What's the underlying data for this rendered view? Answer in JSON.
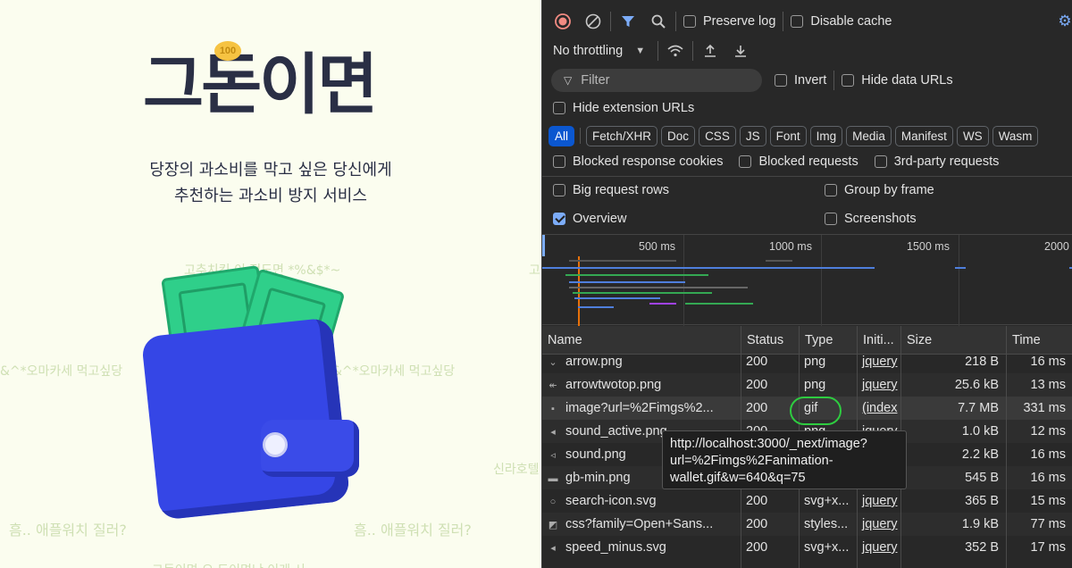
{
  "app": {
    "logo_text": "그돈이면",
    "coin_label": "100",
    "tagline_line1": "당장의 과소비를 막고 싶은 당신에게",
    "tagline_line2": "추천하는 과소비 방지 서비스",
    "bg_texts": [
      "고추치킨 이 정도면 *%&$*~",
      "&^*오마카세 먹고싶당",
      "&^*오마카세 먹고싶당",
      "흠.. 애플워치 질러?",
      "흠.. 애플워치 질러?",
      "신라호텔",
      "고",
      "오마카세",
      "그돈이면 오 도이면난 이게 사"
    ]
  },
  "devtools": {
    "toolbar": {
      "preserve_log": "Preserve log",
      "disable_cache": "Disable cache",
      "throttling": "No throttling"
    },
    "filter": {
      "placeholder": "Filter",
      "invert": "Invert",
      "hide_data_urls": "Hide data URLs",
      "hide_extension_urls": "Hide extension URLs"
    },
    "type_chips": [
      "All",
      "Fetch/XHR",
      "Doc",
      "CSS",
      "JS",
      "Font",
      "Img",
      "Media",
      "Manifest",
      "WS",
      "Wasm"
    ],
    "options": {
      "blocked_cookies": "Blocked response cookies",
      "blocked_requests": "Blocked requests",
      "third_party": "3rd-party requests",
      "big_rows": "Big request rows",
      "group_by_frame": "Group by frame",
      "overview": "Overview",
      "screenshots": "Screenshots"
    },
    "timeline_labels": [
      "500 ms",
      "1000 ms",
      "1500 ms",
      "2000"
    ],
    "columns": [
      "Name",
      "Status",
      "Type",
      "Initi...",
      "Size",
      "Time"
    ],
    "rows": [
      {
        "icon": "⌄",
        "name": "arrow.png",
        "status": "200",
        "type": "png",
        "initiator": "jquery",
        "size": "218 B",
        "time": "16 ms"
      },
      {
        "icon": "↞",
        "name": "arrowtwotop.png",
        "status": "200",
        "type": "png",
        "initiator": "jquery",
        "size": "25.6 kB",
        "time": "13 ms"
      },
      {
        "icon": "▪",
        "name": "image?url=%2Fimgs%2...",
        "status": "200",
        "type": "gif",
        "initiator": "(index",
        "size": "7.7 MB",
        "time": "331 ms"
      },
      {
        "icon": "◂",
        "name": "sound_active.png",
        "status": "200",
        "type": "png",
        "initiator": "jquery",
        "size": "1.0 kB",
        "time": "12 ms"
      },
      {
        "icon": "◃",
        "name": "sound.png",
        "status": "200",
        "type": "png",
        "initiator": "jquery",
        "size": "2.2 kB",
        "time": "16 ms"
      },
      {
        "icon": "▬",
        "name": "gb-min.png",
        "status": "200",
        "type": "png",
        "initiator": "jquery",
        "size": "545 B",
        "time": "16 ms"
      },
      {
        "icon": "○",
        "name": "search-icon.svg",
        "status": "200",
        "type": "svg+x...",
        "initiator": "jquery",
        "size": "365 B",
        "time": "15 ms"
      },
      {
        "icon": "◩",
        "name": "css?family=Open+Sans...",
        "status": "200",
        "type": "styles...",
        "initiator": "jquery",
        "size": "1.9 kB",
        "time": "77 ms"
      },
      {
        "icon": "◂",
        "name": "speed_minus.svg",
        "status": "200",
        "type": "svg+x...",
        "initiator": "jquery",
        "size": "352 B",
        "time": "17 ms"
      }
    ],
    "tooltip": "http://localhost:3000/_next/image?url=%2Fimgs%2Fanimation-wallet.gif&w=640&q=75"
  }
}
